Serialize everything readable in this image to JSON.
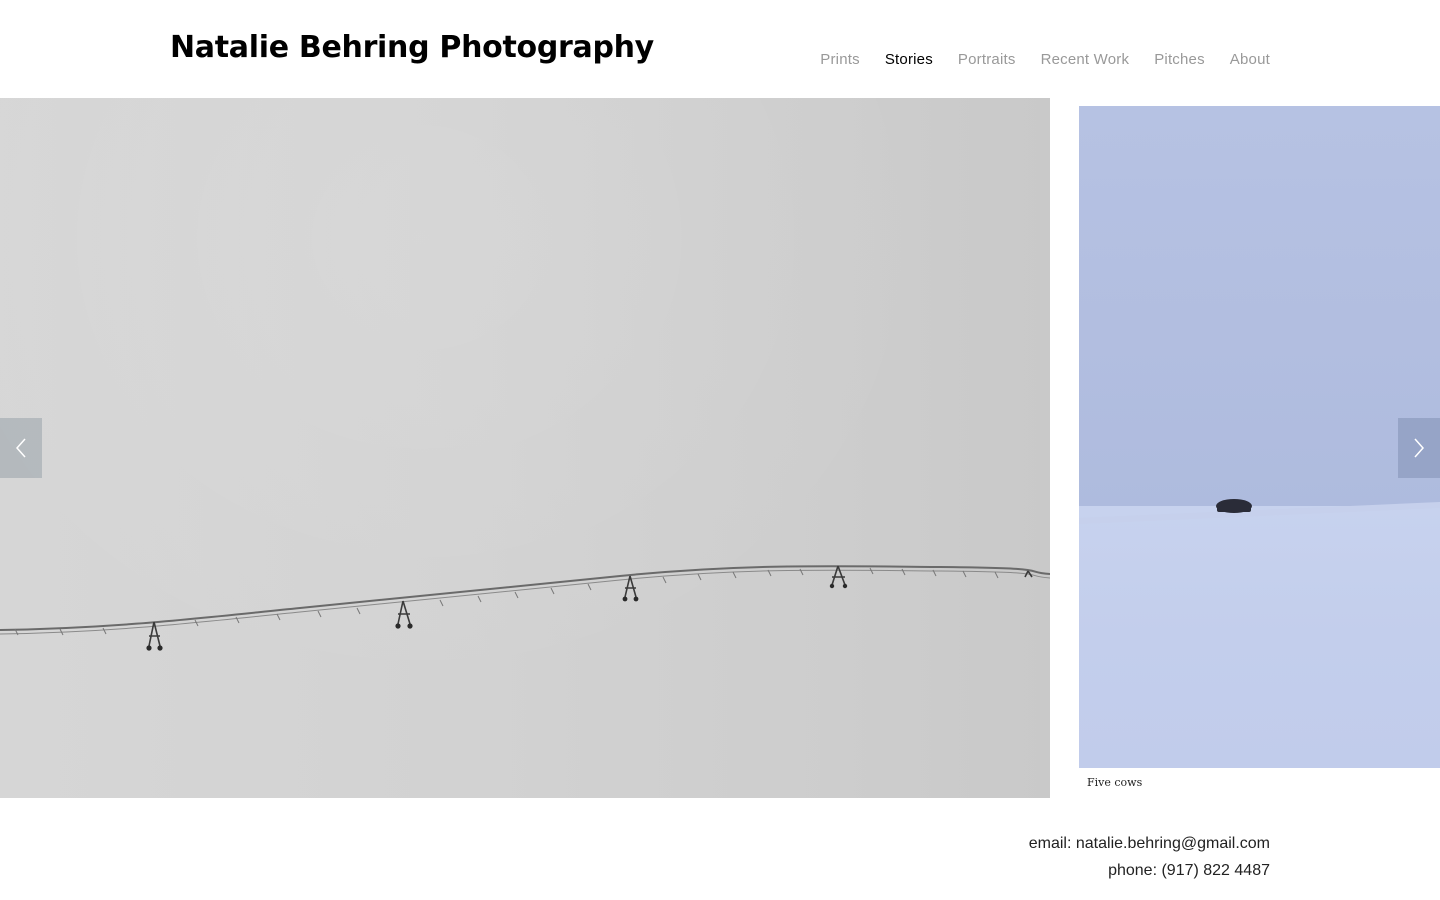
{
  "header": {
    "site_title": "Natalie Behring Photography",
    "nav": [
      {
        "label": "Prints",
        "active": false
      },
      {
        "label": "Stories",
        "active": true
      },
      {
        "label": "Portraits",
        "active": false
      },
      {
        "label": "Recent Work",
        "active": false
      },
      {
        "label": "Pitches",
        "active": false
      },
      {
        "label": "About",
        "active": false
      }
    ]
  },
  "slideshow": {
    "current_slide": {
      "subject": "center-pivot irrigation line across snow field",
      "background_color": "#d2d2d2"
    },
    "next_slide": {
      "caption": "Five cows",
      "sky_color": "#b2bee0",
      "snow_color": "#c3ceec"
    },
    "prev_icon": "chevron-left-icon",
    "next_icon": "chevron-right-icon"
  },
  "contact": {
    "email": "email: natalie.behring@gmail.com",
    "phone": "phone: (917) 822 4487"
  },
  "colors": {
    "nav_inactive": "#999999",
    "nav_active": "#000000",
    "text": "#222222"
  }
}
